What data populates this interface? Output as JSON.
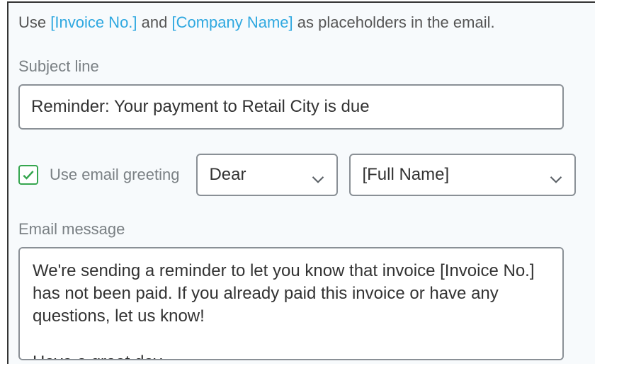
{
  "hint": {
    "prefix": "Use ",
    "placeholder1": "[Invoice No.]",
    "middle": " and ",
    "placeholder2": "[Company Name]",
    "suffix": " as placeholders in the email."
  },
  "subject": {
    "label": "Subject line",
    "value": "Reminder: Your payment to Retail City is due"
  },
  "greeting": {
    "checkbox_checked": true,
    "checkbox_label": "Use email greeting",
    "salutation_selected": "Dear",
    "name_token_selected": "[Full Name]"
  },
  "message": {
    "label": "Email message",
    "value": "We're sending a reminder to let you know that invoice [Invoice No.] has not been paid. If you already paid this invoice or have any questions, let us know!\n\nHave a great day"
  }
}
